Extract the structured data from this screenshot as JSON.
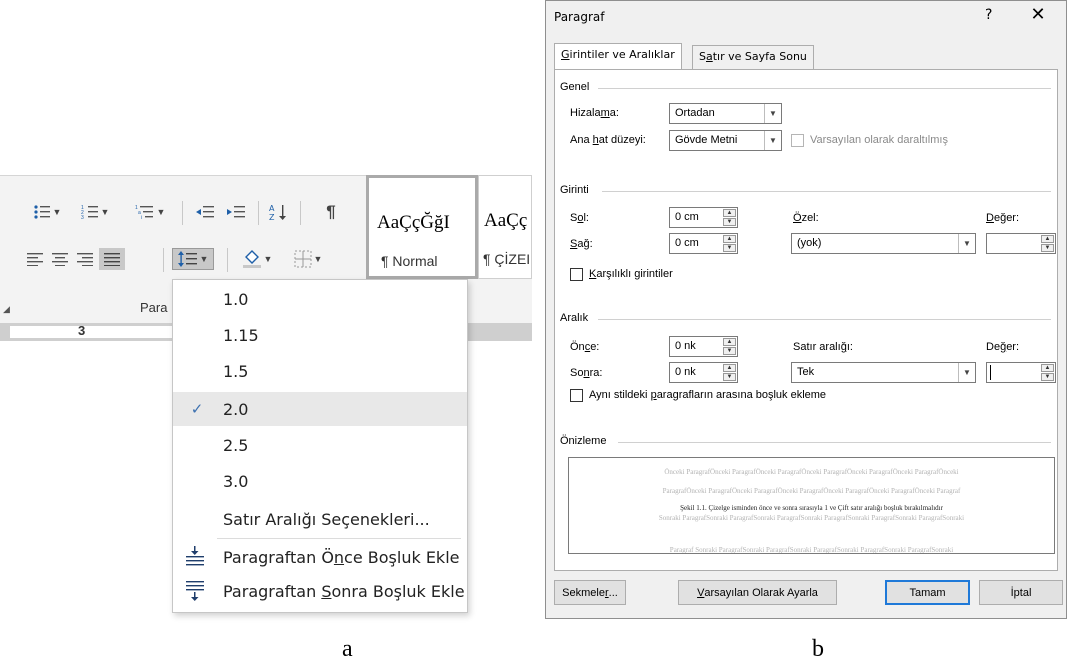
{
  "ribbon": {
    "group_label": "Para",
    "styles": [
      {
        "sample": "AaÇçĞğI",
        "name": "¶ Normal"
      },
      {
        "sample": "AaÇç",
        "name": "¶ ÇİZEI"
      }
    ],
    "ruler_number": "3"
  },
  "line_spacing_menu": {
    "options": [
      {
        "label": "1.0",
        "checked": false
      },
      {
        "label": "1.15",
        "checked": false
      },
      {
        "label": "1.5",
        "checked": false
      },
      {
        "label": "2.0",
        "checked": true
      },
      {
        "label": "2.5",
        "checked": false
      },
      {
        "label": "3.0",
        "checked": false
      }
    ],
    "more_options": "Satır Aralığı Seçenekleri...",
    "add_before": {
      "pre": "Paragraftan Ö",
      "ul": "n",
      "post": "ce Boşluk Ekle"
    },
    "add_after": {
      "pre": "Paragraftan ",
      "ul": "S",
      "post": "onra Boşluk Ekle"
    },
    "check_mark": "✓"
  },
  "captions": {
    "a": "a",
    "b": "b"
  },
  "dialog": {
    "title": "Paragraf",
    "help": "?",
    "close": "✕",
    "tabs": [
      {
        "ul": "G",
        "rest": "irintiler ve Aralıklar"
      },
      {
        "pre": "S",
        "ul": "a",
        "rest": "tır ve Sayfa Sonu"
      }
    ],
    "general": {
      "heading": "Genel",
      "alignment_label": {
        "pre": "Hizala",
        "ul": "m",
        "post": "a:"
      },
      "alignment_value": "Ortadan",
      "outline_label": {
        "pre": "Ana ",
        "ul": "h",
        "post": "at düzeyi:"
      },
      "outline_value": "Gövde Metni",
      "collapsed_label": "Varsayılan olarak daraltılmış"
    },
    "indent": {
      "heading": "Girinti",
      "left_label": {
        "pre": "S",
        "ul": "o",
        "post": "l:"
      },
      "left_value": "0 cm",
      "right_label": {
        "pre": "",
        "ul": "S",
        "post": "ağ:"
      },
      "right_value": "0 cm",
      "special_label": {
        "pre": "",
        "ul": "Ö",
        "post": "zel:"
      },
      "special_value": "(yok)",
      "by_label": {
        "pre": "",
        "ul": "D",
        "post": "eğer:"
      },
      "by_value": "",
      "mirror_label": {
        "pre": "",
        "ul": "K",
        "post": "arşılıklı girintiler"
      }
    },
    "spacing": {
      "heading": "Aralık",
      "before_label": {
        "pre": "Ön",
        "ul": "c",
        "post": "e:"
      },
      "before_value": "0 nk",
      "after_label": {
        "pre": "So",
        "ul": "n",
        "post": "ra:"
      },
      "after_value": "0 nk",
      "line_label": {
        "pre": "Satır aralı",
        "ul": "ğ",
        "post": "ı:"
      },
      "line_value": "Tek",
      "at_label": {
        "pre": "De",
        "ul": "ğ",
        "post": "er:"
      },
      "at_value": "",
      "no_space_label": {
        "pre": "Aynı stildeki ",
        "ul": "p",
        "post": "aragrafların arasına boşluk ekleme"
      }
    },
    "preview": {
      "heading": "Önizleme",
      "prev1": "Önceki ParagrafÖnceki ParagrafÖnceki ParagrafÖnceki ParagrafÖnceki ParagrafÖnceki ParagrafÖnceki",
      "prev2": "ParagrafÖnceki ParagrafÖnceki ParagrafÖnceki ParagrafÖnceki ParagrafÖnceki ParagrafÖnceki Paragraf",
      "main": "Şekil 1.1. Çizelge isminden önce ve sonra sırasıyla 1 ve Çift satır aralığı boşluk bırakılmalıdır",
      "next1": "Sonraki ParagrafSonraki ParagrafSonraki ParagrafSonraki ParagrafSonraki ParagrafSonraki ParagrafSonraki",
      "next2": "Paragraf Sonraki ParagrafSonraki ParagrafSonraki ParagrafSonraki ParagrafSonraki ParagrafSonraki"
    },
    "buttons": {
      "tabs": {
        "pre": "Sekmele",
        "ul": "r",
        "post": "..."
      },
      "default": {
        "pre": "",
        "ul": "V",
        "post": "arsayılan Olarak Ayarla"
      },
      "ok": "Tamam",
      "cancel": "İptal"
    }
  }
}
